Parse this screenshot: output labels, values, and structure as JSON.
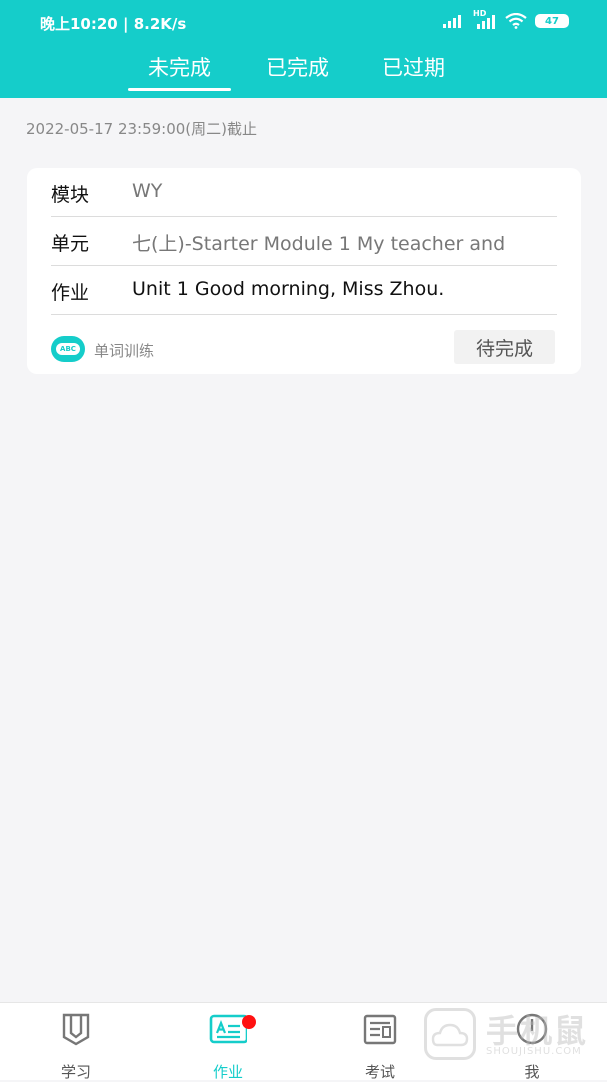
{
  "status": {
    "time": "晚上10:20",
    "speed": "8.2K/s",
    "battery": "47",
    "hd": "HD"
  },
  "tabs": [
    {
      "label": "未完成"
    },
    {
      "label": "已完成"
    },
    {
      "label": "已过期"
    }
  ],
  "deadline": "2022-05-17 23:59:00(周二)截止",
  "card": {
    "module_label": "模块",
    "module_value": "WY",
    "unit_label": "单元",
    "unit_value": "七(上)-Starter Module 1  My teacher and",
    "homework_label": "作业",
    "homework_value": "Unit 1 Good morning, Miss Zhou.",
    "type_icon_text": "ABC",
    "type_label": "单词训练",
    "status_button": "待完成"
  },
  "nav": {
    "items": [
      {
        "label": "学习",
        "icon": "book-icon"
      },
      {
        "label": "作业",
        "icon": "homework-icon"
      },
      {
        "label": "考试",
        "icon": "exam-icon"
      },
      {
        "label": "我",
        "icon": "profile-icon"
      }
    ]
  },
  "watermark": {
    "text": "手机鼠",
    "sub": "SHOUJISHU.COM"
  },
  "colors": {
    "accent": "#15cdca",
    "badge": "#ff1111"
  }
}
